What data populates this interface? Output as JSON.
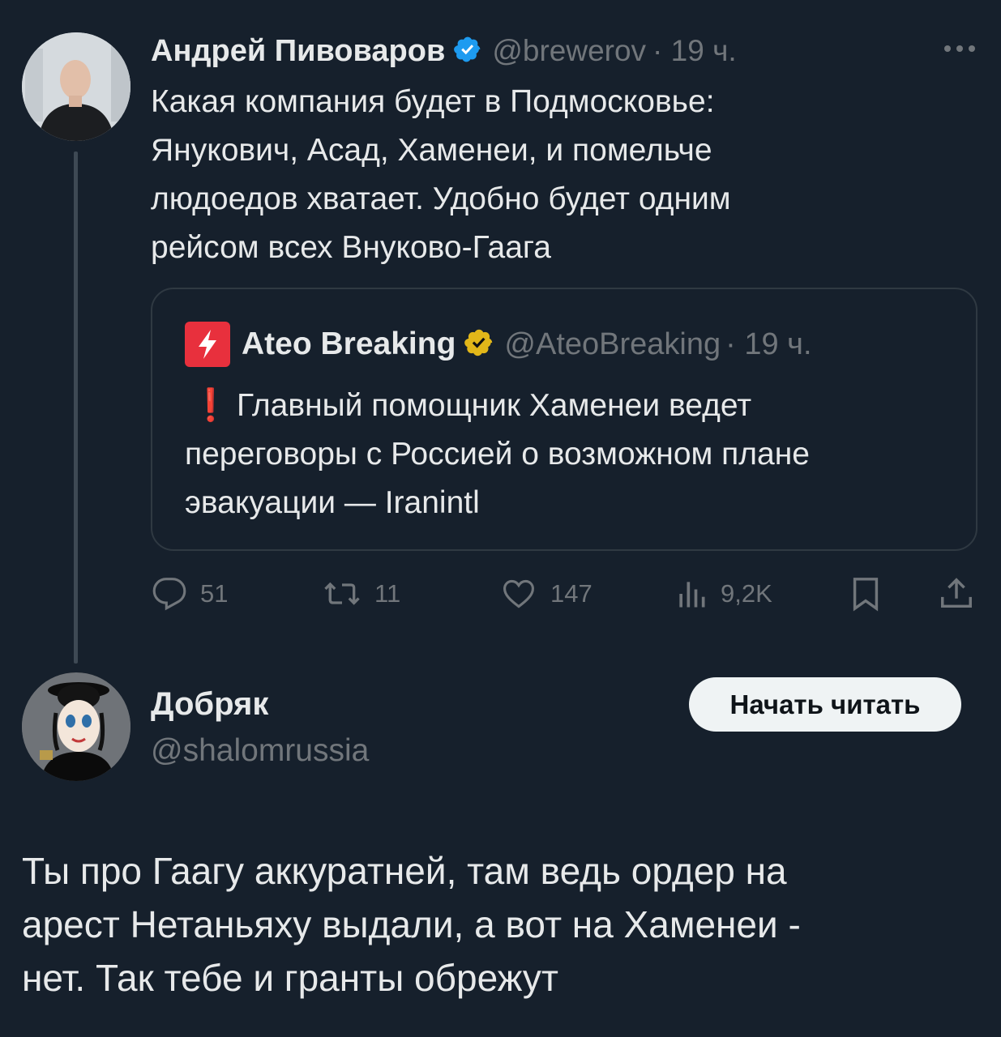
{
  "tweet": {
    "author_name": "Андрей Пивоваров",
    "author_handle": "@brewerov",
    "time": "· 19 ч.",
    "verified_icon": "blue-check-icon",
    "text_lines": [
      "Какая компания будет в Подмосковье:",
      "Янукович, Асад, Хаменеи, и помельче",
      "людоедов хватает. Удобно  будет одним",
      "рейсом всех  Внуково-Гаага"
    ],
    "quote": {
      "author_name": "Ateo Breaking",
      "author_handle": "@AteoBreaking",
      "time": "· 19 ч.",
      "verified_icon": "gold-check-icon",
      "exclamation": "❗",
      "text_lines": [
        "Главный помощник Хаменеи ведет",
        "переговоры с Россией о возможном плане",
        "эвакуации — Iranintl"
      ]
    },
    "actions": {
      "replies": "51",
      "retweets": "11",
      "likes": "147",
      "views": "9,2K"
    }
  },
  "reply": {
    "author_name": "Добряк",
    "author_handle": "@shalomrussia",
    "follow_label": "Начать читать",
    "text_lines": [
      "Ты про Гаагу аккуратней, там ведь ордер на",
      "арест Нетаньяху выдали, а вот на Хаменеи -",
      "нет. Так тебе и гранты обрежут"
    ]
  },
  "colors": {
    "background": "#16202c",
    "verified_blue": "#1d9bf0",
    "verified_gold": "#e2b719",
    "ateo_red": "#e8303d",
    "muted_text": "#71767b"
  }
}
